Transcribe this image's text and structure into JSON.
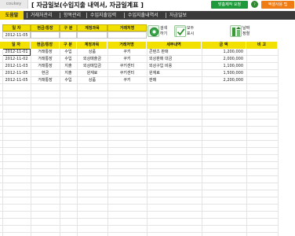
{
  "app": {
    "logo": "coukey",
    "title": "[ 자금일보(수입지출 내역서, 자금일계표 ]"
  },
  "header_buttons": {
    "custom_request": "맞춤제작 요청",
    "help_icon": "?",
    "paid_version": "엑셀사용 팁"
  },
  "nav": {
    "items": [
      {
        "label": "도움말",
        "active": true
      },
      {
        "label": "거래처관리",
        "active": false
      },
      {
        "label": "항목관리",
        "active": false
      },
      {
        "label": "수입지출입력",
        "active": false
      },
      {
        "label": "수입지출내역서",
        "active": false
      },
      {
        "label": "자금일보",
        "active": false
      }
    ]
  },
  "filter": {
    "headers": [
      "일 자",
      "현금/통장",
      "구 분",
      "계정과목",
      "거래처명"
    ],
    "values": [
      "2012-11-05",
      "",
      "",
      "",
      ""
    ]
  },
  "buttons": {
    "search": {
      "label": "검색\n하기",
      "icon": "search-icon",
      "color": "#2e9e3e"
    },
    "show_all": {
      "label": "모두\n표시",
      "icon": "checkmark-icon",
      "color": "#3b9b3b"
    },
    "sort_date": {
      "label": "날짜\n정렬",
      "icon": "sort-icon",
      "color": "#3b9b3b"
    }
  },
  "table": {
    "columns": [
      "일 자",
      "현금/통장",
      "구 분",
      "계정과목",
      "거래처명",
      "세부내역",
      "금 액",
      "비 고"
    ],
    "rows": [
      [
        "2012-11-01",
        "거래통장",
        "수입",
        "상품",
        "쿠키",
        "콘텐츠 판매",
        "1,200,000",
        ""
      ],
      [
        "2012-11-02",
        "거래통장",
        "수입",
        "외상매출금",
        "쿠키",
        "외상판매 대금",
        "2,000,000",
        ""
      ],
      [
        "2012-11-03",
        "거래통장",
        "지출",
        "외상매입금",
        "쿠키센터",
        "외상구입 비용",
        "1,100,000",
        ""
      ],
      [
        "2012-11-05",
        "현금",
        "지출",
        "원재료",
        "쿠키센터",
        "원재료",
        "1,500,000",
        ""
      ],
      [
        "2012-11-05",
        "거래통장",
        "수입",
        "상품",
        "쿠키",
        "판매",
        "2,200,000",
        ""
      ]
    ],
    "empty_rows": 22
  },
  "colors": {
    "accent_yellow": "#f2e000",
    "nav_dark": "#3a3a3a",
    "green": "#1e9a3c",
    "orange": "#ee7b14"
  }
}
